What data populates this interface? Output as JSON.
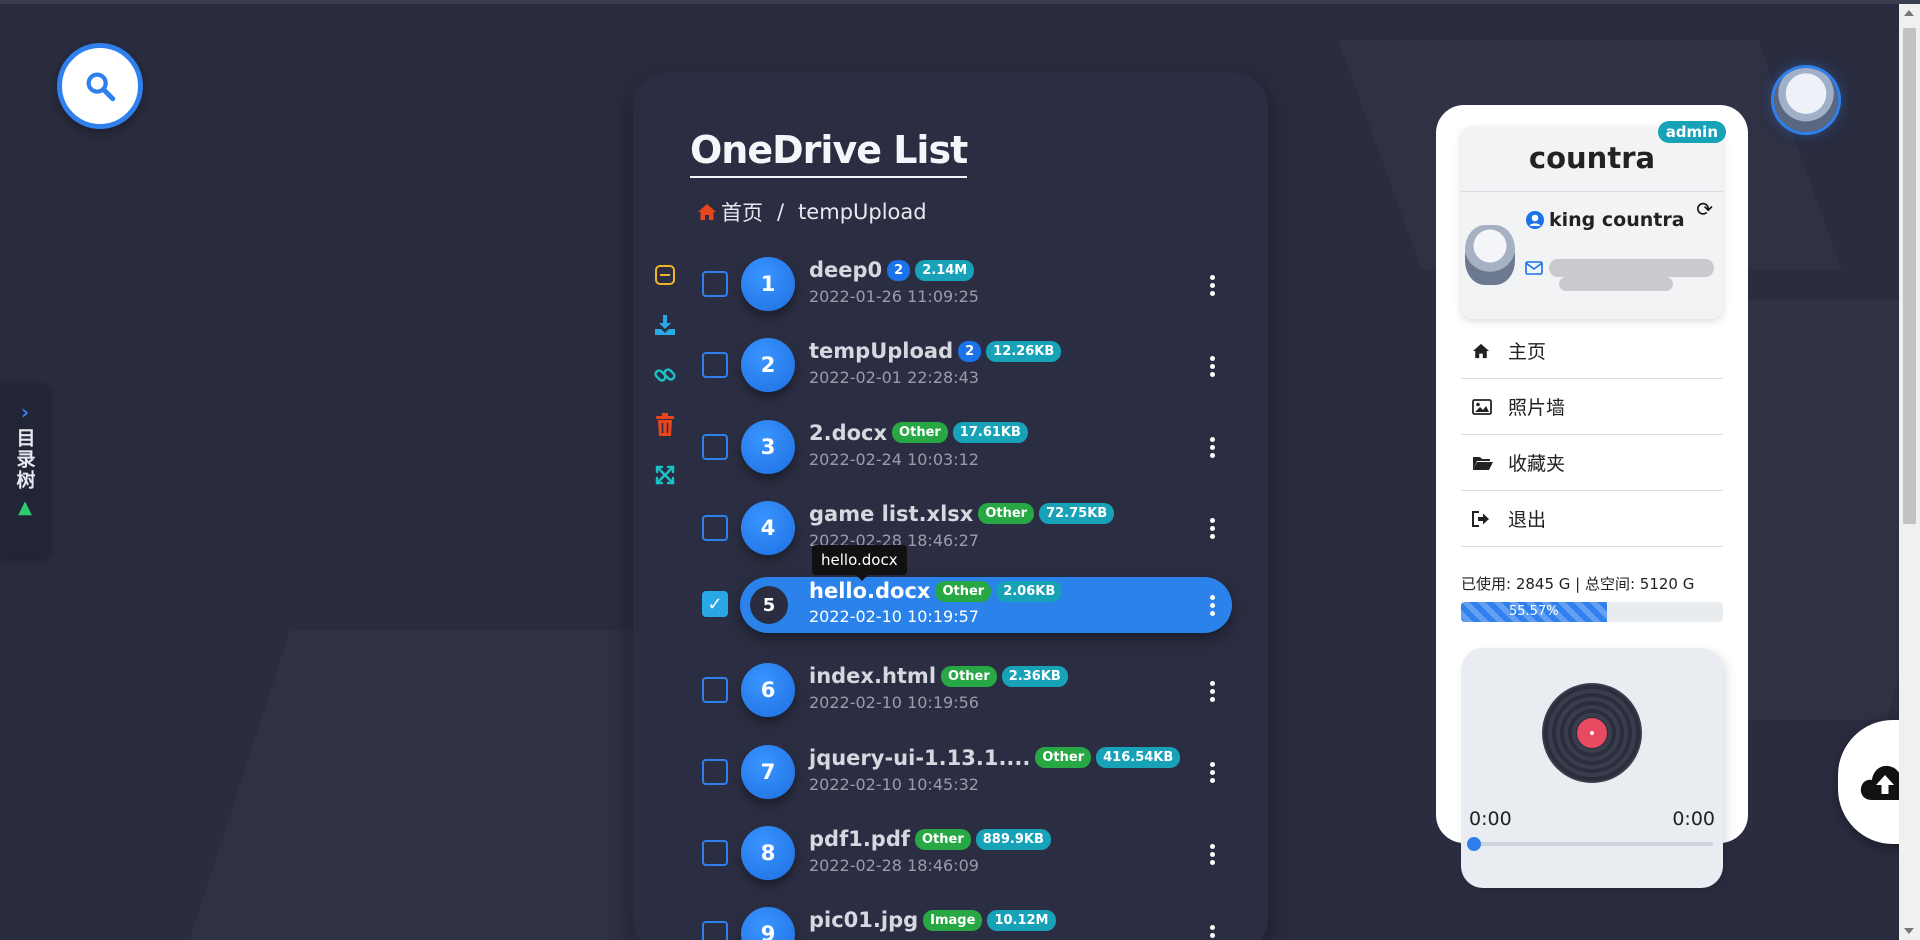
{
  "app": {
    "title": "OneDrive List"
  },
  "breadcrumb": {
    "home": "首页",
    "separator": "/",
    "current": "tempUpload"
  },
  "dir_tree": {
    "label": "目录树"
  },
  "tooltip": "hello.docx",
  "files": [
    {
      "index": "1",
      "name": "deep0",
      "badges": [
        {
          "text": "2",
          "kind": "blue"
        },
        {
          "text": "2.14M",
          "kind": "teal"
        }
      ],
      "date": "2022-01-26 11:09:25",
      "checked": false
    },
    {
      "index": "2",
      "name": "tempUpload",
      "badges": [
        {
          "text": "2",
          "kind": "blue"
        },
        {
          "text": "12.26KB",
          "kind": "teal"
        }
      ],
      "date": "2022-02-01 22:28:43",
      "checked": false
    },
    {
      "index": "3",
      "name": "2.docx",
      "badges": [
        {
          "text": "Other",
          "kind": "green"
        },
        {
          "text": "17.61KB",
          "kind": "teal"
        }
      ],
      "date": "2022-02-24 10:03:12",
      "checked": false
    },
    {
      "index": "4",
      "name": "game list.xlsx",
      "badges": [
        {
          "text": "Other",
          "kind": "green"
        },
        {
          "text": "72.75KB",
          "kind": "teal"
        }
      ],
      "date": "2022-02-28 18:46:27",
      "checked": false
    },
    {
      "index": "5",
      "name": "hello.docx",
      "badges": [
        {
          "text": "Other",
          "kind": "green"
        },
        {
          "text": "2.06KB",
          "kind": "teal"
        }
      ],
      "date": "2022-02-10 10:19:57",
      "checked": true
    },
    {
      "index": "6",
      "name": "index.html",
      "badges": [
        {
          "text": "Other",
          "kind": "green"
        },
        {
          "text": "2.36KB",
          "kind": "teal"
        }
      ],
      "date": "2022-02-10 10:19:56",
      "checked": false
    },
    {
      "index": "7",
      "name": "jquery-ui-1.13.1....",
      "badges": [
        {
          "text": "Other",
          "kind": "green"
        },
        {
          "text": "416.54KB",
          "kind": "teal"
        }
      ],
      "date": "2022-02-10 10:45:32",
      "checked": false
    },
    {
      "index": "8",
      "name": "pdf1.pdf",
      "badges": [
        {
          "text": "Other",
          "kind": "green"
        },
        {
          "text": "889.9KB",
          "kind": "teal"
        }
      ],
      "date": "2022-02-28 18:46:09",
      "checked": false
    },
    {
      "index": "9",
      "name": "pic01.jpg",
      "badges": [
        {
          "text": "Image",
          "kind": "green"
        },
        {
          "text": "10.12M",
          "kind": "teal"
        }
      ],
      "date": "",
      "checked": false
    }
  ],
  "toolbar_icons": [
    "select-toggle-icon",
    "download-icon",
    "link-icon",
    "trash-icon",
    "expand-icon"
  ],
  "profile": {
    "role_badge": "admin",
    "username": "countra",
    "display_name": "king countra"
  },
  "menu": [
    {
      "label": "主页",
      "icon": "home-icon"
    },
    {
      "label": "照片墙",
      "icon": "image-icon"
    },
    {
      "label": "收藏夹",
      "icon": "folder-open-icon"
    },
    {
      "label": "退出",
      "icon": "sign-out-icon"
    }
  ],
  "storage": {
    "text": "已使用: 2845 G | 总空间: 5120 G",
    "percent_label": "55.57%",
    "percent": 55.57
  },
  "player": {
    "current_time": "0:00",
    "duration": "0:00",
    "progress": 0
  },
  "colors": {
    "accent": "#2f80ed",
    "background": "#2a2d40",
    "teal": "#17a2b8",
    "green": "#28a745",
    "danger": "#e8461c"
  }
}
